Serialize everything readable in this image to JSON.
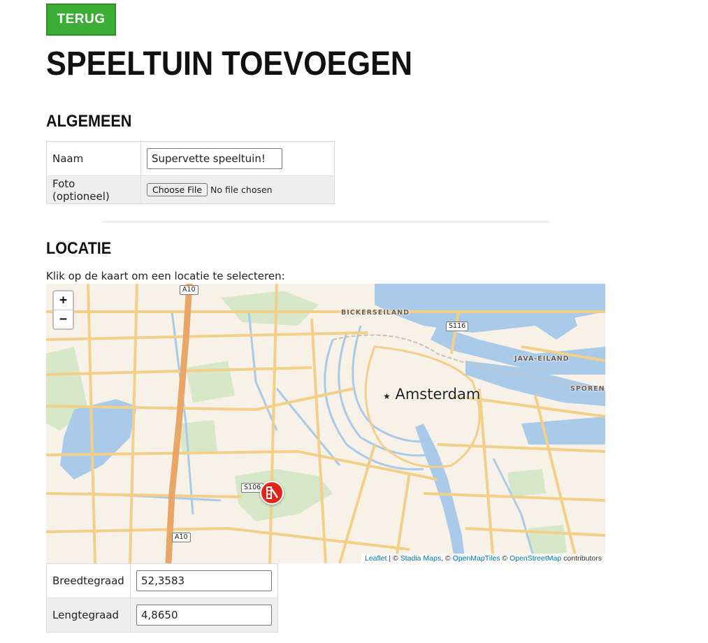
{
  "back_button": {
    "label": "TERUG"
  },
  "page_title": "SPEELTUIN TOEVOEGEN",
  "general": {
    "heading": "ALGEMEEN",
    "name_label": "Naam",
    "name_value": "Supervette speeltuin!",
    "photo_label": "Foto (optioneel)",
    "file_button": "Choose File",
    "file_status": "No file chosen"
  },
  "location": {
    "heading": "LOCATIE",
    "hint": "Klik op de kaart om een locatie te selecteren:",
    "latitude_label": "Breedtegraad",
    "latitude_value": "52,3583",
    "longitude_label": "Lengtegraad",
    "longitude_value": "4,8650"
  },
  "map": {
    "zoom_in": "+",
    "zoom_out": "−",
    "city": "Amsterdam",
    "city_icon": "★",
    "districts": [
      "BICKERSEILAND",
      "JAVA-EILAND",
      "SPORENE"
    ],
    "road_shields": [
      "A10",
      "S116",
      "S106",
      "A10"
    ],
    "attribution": {
      "leaflet": "Leaflet",
      "sep": " | © ",
      "stadia": "Stadia Maps",
      "sep2": ", © ",
      "openmaptiles": "OpenMapTiles",
      "sep3": " © ",
      "osm": "OpenStreetMap",
      "tail": " contributors"
    },
    "marker_icon": "playground-slide-icon",
    "colors": {
      "water": "#a9cbe9",
      "park": "#d6e8c8",
      "road": "#f3d08a",
      "highway": "#e8a668",
      "land": "#f7f1e8"
    }
  },
  "colors": {
    "accent": "#3cae35"
  }
}
